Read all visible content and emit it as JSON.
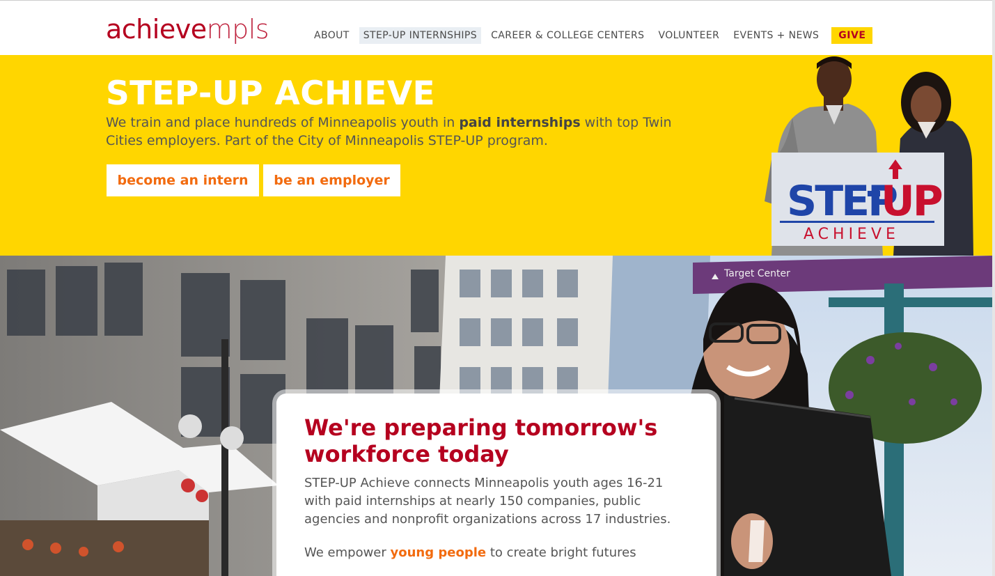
{
  "header": {
    "logo_part1": "achieve",
    "logo_part2": "mpls",
    "nav": [
      {
        "label": "ABOUT"
      },
      {
        "label": "STEP-UP INTERNSHIPS"
      },
      {
        "label": "CAREER & COLLEGE CENTERS"
      },
      {
        "label": "VOLUNTEER"
      },
      {
        "label": "EVENTS + NEWS"
      }
    ],
    "give_label": "GIVE"
  },
  "hero": {
    "title": "STEP-UP ACHIEVE",
    "text_before": "We train and place hundreds of Minneapolis youth in ",
    "text_bold": "paid internships",
    "text_after": " with top Twin Cities employers. Part of the City of Minneapolis STEP-UP program.",
    "btn_intern": "become an intern",
    "btn_employer": "be an employer",
    "logo_step": "STEP",
    "logo_up": "UP",
    "logo_achieve": "ACHIEVE"
  },
  "photo": {
    "sign_text": "Target Center"
  },
  "card": {
    "title": "We're preparing tomorrow's workforce today",
    "p1": "STEP-UP Achieve connects Minneapolis youth ages 16-21 with paid internships at nearly 150 companies, public agencies and nonprofit organizations across 17 industries.",
    "p2_before": "We empower ",
    "p2_link": "young people",
    "p2_after": " to create bright futures"
  },
  "colors": {
    "brand_red": "#b5001f",
    "brand_yellow": "#ffd600",
    "accent_orange": "#f26b0f",
    "logo_blue": "#1f45a8"
  }
}
